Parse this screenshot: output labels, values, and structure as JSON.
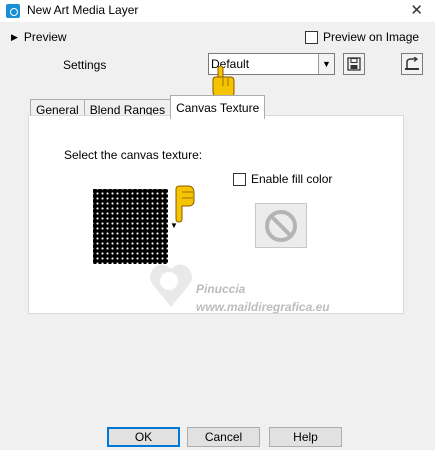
{
  "window": {
    "title": "New Art Media Layer",
    "close_glyph": "✕",
    "icon": "camera-app-icon"
  },
  "preview": {
    "toggle_label": "Preview",
    "on_image_label": "Preview on Image",
    "on_image_checked": false
  },
  "settings": {
    "label": "Settings",
    "value": "Default"
  },
  "tabs": [
    {
      "label": "General",
      "active": false
    },
    {
      "label": "Blend Ranges",
      "active": false
    },
    {
      "label": "Canvas Texture",
      "active": true
    }
  ],
  "canvas_texture": {
    "select_label": "Select the canvas texture:",
    "enable_fill_label": "Enable fill color",
    "enable_fill_checked": false
  },
  "watermark": {
    "name": "Pinuccia",
    "url": "www.maildiregrafica.eu"
  },
  "buttons": {
    "ok": "OK",
    "cancel": "Cancel",
    "help": "Help"
  },
  "colors": {
    "accent": "#0078d7",
    "pointer_hand": "#f5c400",
    "texture": "#000000"
  }
}
